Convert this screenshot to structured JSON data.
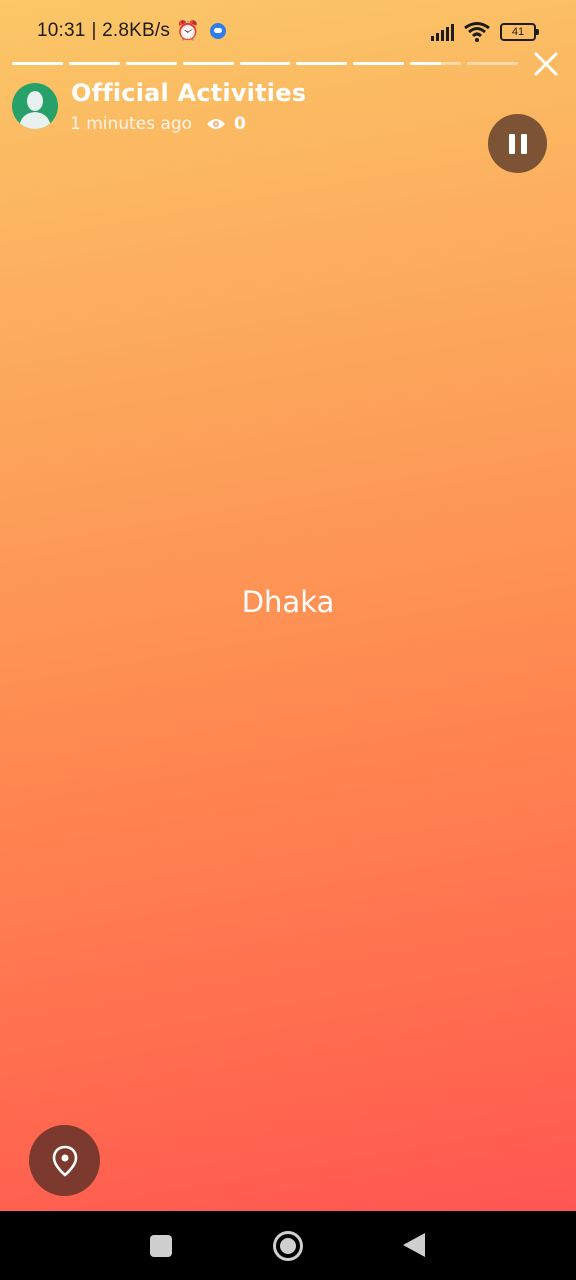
{
  "status": {
    "time": "10:31",
    "speed": "| 2.8KB/s",
    "battery": "41"
  },
  "story": {
    "segments": [
      1,
      1,
      1,
      1,
      1,
      1,
      1,
      0.6,
      0
    ],
    "author": "Official Activities",
    "time_ago": "1 minutes ago",
    "views": "0",
    "text": "Dhaka"
  },
  "icons": {
    "close": "close-icon",
    "pause": "pause-icon",
    "eye": "eye-icon",
    "location": "location-pin-icon",
    "avatar": "user-avatar-icon"
  }
}
